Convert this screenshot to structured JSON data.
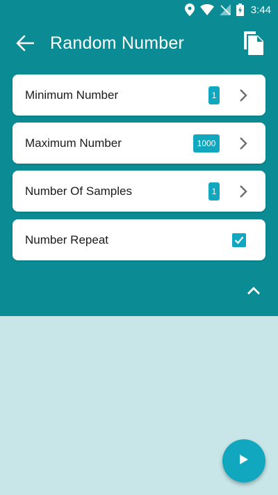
{
  "statusbar": {
    "time": "3:44",
    "icons": [
      "location-icon",
      "wifi-icon",
      "signal-icon",
      "battery-charging-icon"
    ]
  },
  "toolbar": {
    "title": "Random Number",
    "back_icon": "arrow-left-icon",
    "copy_icon": "copy-icon"
  },
  "settings": [
    {
      "label": "Minimum Number",
      "value": "1"
    },
    {
      "label": "Maximum Number",
      "value": "1000"
    },
    {
      "label": "Number Of Samples",
      "value": "1"
    },
    {
      "label": "Number Repeat",
      "checked": true
    }
  ],
  "colors": {
    "header": "#0b8b93",
    "accent": "#10a7bf",
    "background": "#c8e6e8"
  },
  "fab": {
    "icon": "play-icon"
  },
  "collapse": {
    "icon": "chevron-up-icon"
  }
}
